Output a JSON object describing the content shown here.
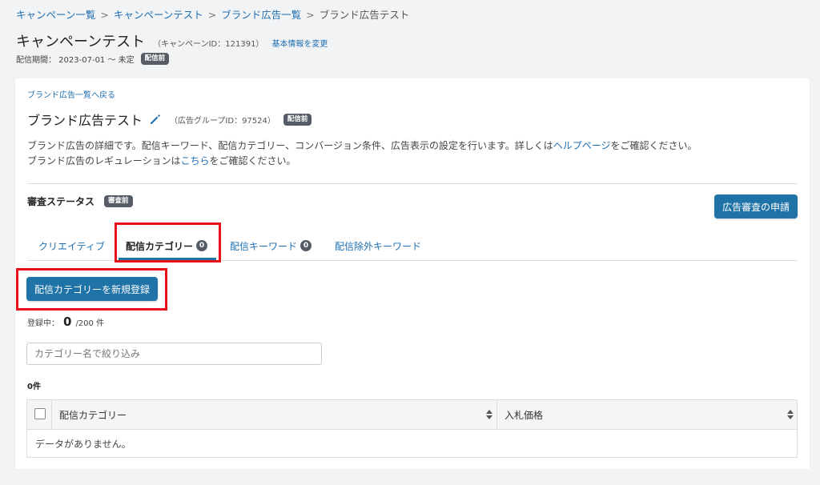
{
  "breadcrumb": {
    "items": [
      "キャンペーン一覧",
      "キャンペーンテスト",
      "ブランド広告一覧"
    ],
    "current": "ブランド広告テスト",
    "separator": ">"
  },
  "campaign": {
    "name": "キャンペーンテスト",
    "id_text": "（キャンペーンID：121391）",
    "edit_link": "基本情報を変更",
    "period": "配信期間： 2023-07-01 〜 未定",
    "status_badge": "配信前"
  },
  "ad_group": {
    "back_link": "ブランド広告一覧へ戻る",
    "name": "ブランド広告テスト",
    "id_text": "（広告グループID：97524）",
    "status_badge": "配信前",
    "desc_line1_pre": "ブランド広告の詳細です。配信キーワード、配信カテゴリー、コンバージョン条件、広告表示の設定を行います。詳しくは",
    "help_link": "ヘルプページ",
    "desc_line1_post": "をご確認ください。",
    "desc_line2_pre": "ブランド広告のレギュレーションは",
    "here_link": "こちら",
    "desc_line2_post": "をご確認ください。"
  },
  "review": {
    "label": "審査ステータス",
    "badge": "審査前",
    "apply_button": "広告審査の申請"
  },
  "tabs": [
    {
      "label": "クリエイティブ"
    },
    {
      "label": "配信カテゴリー",
      "count": "0"
    },
    {
      "label": "配信キーワード",
      "count": "0"
    },
    {
      "label": "配信除外キーワード"
    }
  ],
  "category": {
    "new_button": "配信カテゴリーを新規登録",
    "registered_label": "登録中：",
    "registered_count": "0",
    "registered_max": "/200 件",
    "filter_placeholder": "カテゴリー名で絞り込み",
    "result_count": "0件"
  },
  "table": {
    "columns": [
      "配信カテゴリー",
      "入札価格"
    ],
    "empty_message": "データがありません。"
  },
  "colors": {
    "primary": "#1f73a7",
    "link": "#1f6fb2",
    "badge": "#555c66",
    "highlight": "#e8101a"
  }
}
